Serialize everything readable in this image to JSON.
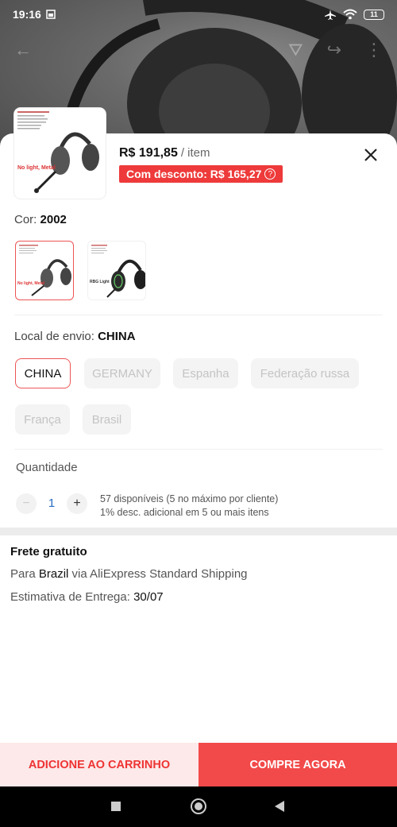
{
  "status": {
    "time": "19:16",
    "battery": "11"
  },
  "product": {
    "price": "R$ 191,85",
    "per": "/ item",
    "discount": "Com desconto: R$ 165,27",
    "thumb_text": "No light, Metal"
  },
  "color": {
    "label": "Cor:",
    "value": "2002",
    "options": [
      {
        "caption": "No light, Metal"
      },
      {
        "caption": "RBG Light"
      }
    ]
  },
  "shipping_from": {
    "label": "Local de envio:",
    "value": "CHINA",
    "options": [
      "CHINA",
      "GERMANY",
      "Espanha",
      "Federação russa",
      "França",
      "Brasil"
    ]
  },
  "quantity": {
    "label": "Quantidade",
    "value": "1",
    "minus": "−",
    "plus": "+",
    "available": "57 disponíveis (5 no máximo por cliente)",
    "bulk": "1% desc. adicional em 5 ou mais itens"
  },
  "delivery": {
    "free": "Frete gratuito",
    "to_prefix": "Para",
    "to_country": "Brazil",
    "via": "via AliExpress Standard Shipping",
    "eta_label": "Estimativa de Entrega:",
    "eta_value": "30/07"
  },
  "actions": {
    "add_to_cart": "ADICIONE AO CARRINHO",
    "buy_now": "COMPRE AGORA"
  },
  "colors": {
    "accent": "#f24a4a",
    "accent_light": "#fde9e9",
    "selected_border": "#ee5555"
  }
}
